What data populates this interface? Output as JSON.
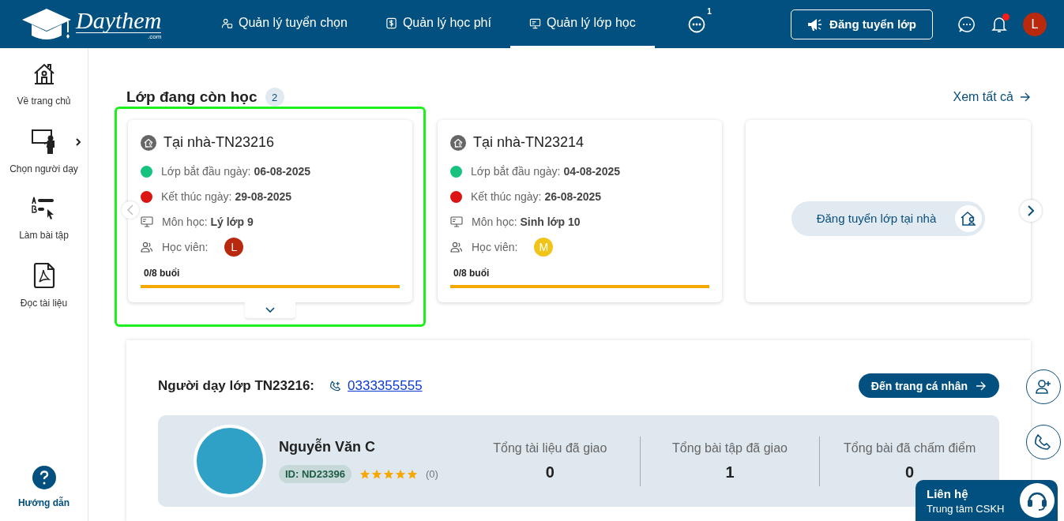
{
  "header": {
    "logo": {
      "name": "Daythem",
      "suffix": ".com"
    },
    "nav": [
      {
        "label": "Quản lý tuyển chọn",
        "selected": false
      },
      {
        "label": "Quản lý học phí",
        "selected": false
      },
      {
        "label": "Quản lý lớp học",
        "selected": true
      }
    ],
    "more_badge": "1",
    "post_button": "Đăng tuyển lớp",
    "notification_unread": true,
    "avatar": "L"
  },
  "sidebar": {
    "items": [
      {
        "label": "Về trang chủ",
        "expandable": false
      },
      {
        "label": "Chọn người dạy",
        "expandable": true
      },
      {
        "label": "Làm bài tập",
        "expandable": false
      },
      {
        "label": "Đọc tài liệu",
        "expandable": false
      }
    ],
    "help": "Hướng dẫn"
  },
  "section": {
    "title": "Lớp đang còn học",
    "count": "2",
    "view_all": "Xem tất cả"
  },
  "classes": [
    {
      "title": "Tại nhà-TN23216",
      "start": "Lớp bắt đầu ngày: **06-08-2025**",
      "end": "Kết thúc ngày: **29-08-2025**",
      "subject": "Môn học: **Lý lớp 9**",
      "students_label": "Học viên:",
      "student_initial": "L",
      "color": "#b8290e",
      "sessions": "0/8 buổi",
      "selected": true
    },
    {
      "title": "Tại nhà-TN23214",
      "start": "Lớp bắt đầu ngày: **04-08-2025**",
      "end": "Kết thúc ngày: **26-08-2025**",
      "subject": "Môn học: **Sinh lớp 10**",
      "students_label": "Học viên:",
      "student_initial": "M",
      "color": "#f0c419",
      "sessions": "0/8 buổi",
      "selected": false
    }
  ],
  "post_card": {
    "button": "Đăng tuyển lớp tại nhà"
  },
  "teacher": {
    "heading": "Người dạy lớp TN23216:",
    "phone": "0333355555",
    "profile_button": "Đến trang cá nhân",
    "name": "Nguyễn Văn C",
    "id": "ID: ND23396",
    "stars": 5,
    "reviews": "(0)",
    "stats": [
      {
        "label": "Tổng tài liệu đã giao",
        "value": "0"
      },
      {
        "label": "Tổng bài tập đã giao",
        "value": "1"
      },
      {
        "label": "Tổng bài đã chấm điểm",
        "value": "0"
      }
    ]
  },
  "contact": {
    "title": "Liên hệ",
    "subtitle": "Trung tâm CSKH"
  }
}
